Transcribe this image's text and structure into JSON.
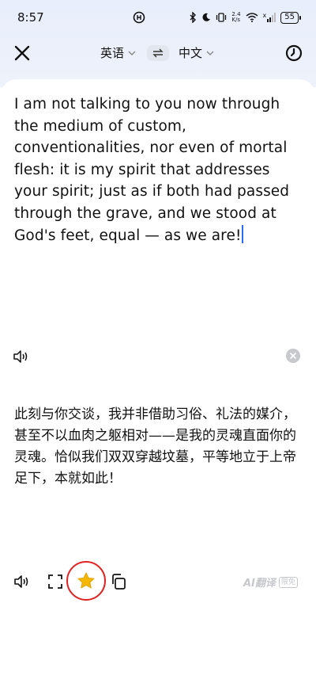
{
  "status_bar": {
    "time": "8:57",
    "net_speed_value": "2.4",
    "net_speed_unit": "K/s",
    "battery": "55",
    "signal_label": "x"
  },
  "toolbar": {
    "source_lang": "英语",
    "target_lang": "中文"
  },
  "source": {
    "text": "I am not talking to you now through the medium of custom, conventionalities, nor even of mortal flesh: it is my spirit that addresses your spirit; just as if both had passed through the grave, and we stood at God's feet, equal — as we are!"
  },
  "translation": {
    "text": "此刻与你交谈，我并非借助习俗、礼法的媒介，甚至不以血肉之躯相对——是我的灵魂直面你的灵魂。恰似我们双双穿越坟墓，平等地立于上帝足下，本就如此！"
  },
  "footer": {
    "brand": "AI翻译",
    "brand_tag": "限免"
  },
  "colors": {
    "accent": "#2d6cf6",
    "star": "#f5b800",
    "highlight": "#e02424"
  }
}
